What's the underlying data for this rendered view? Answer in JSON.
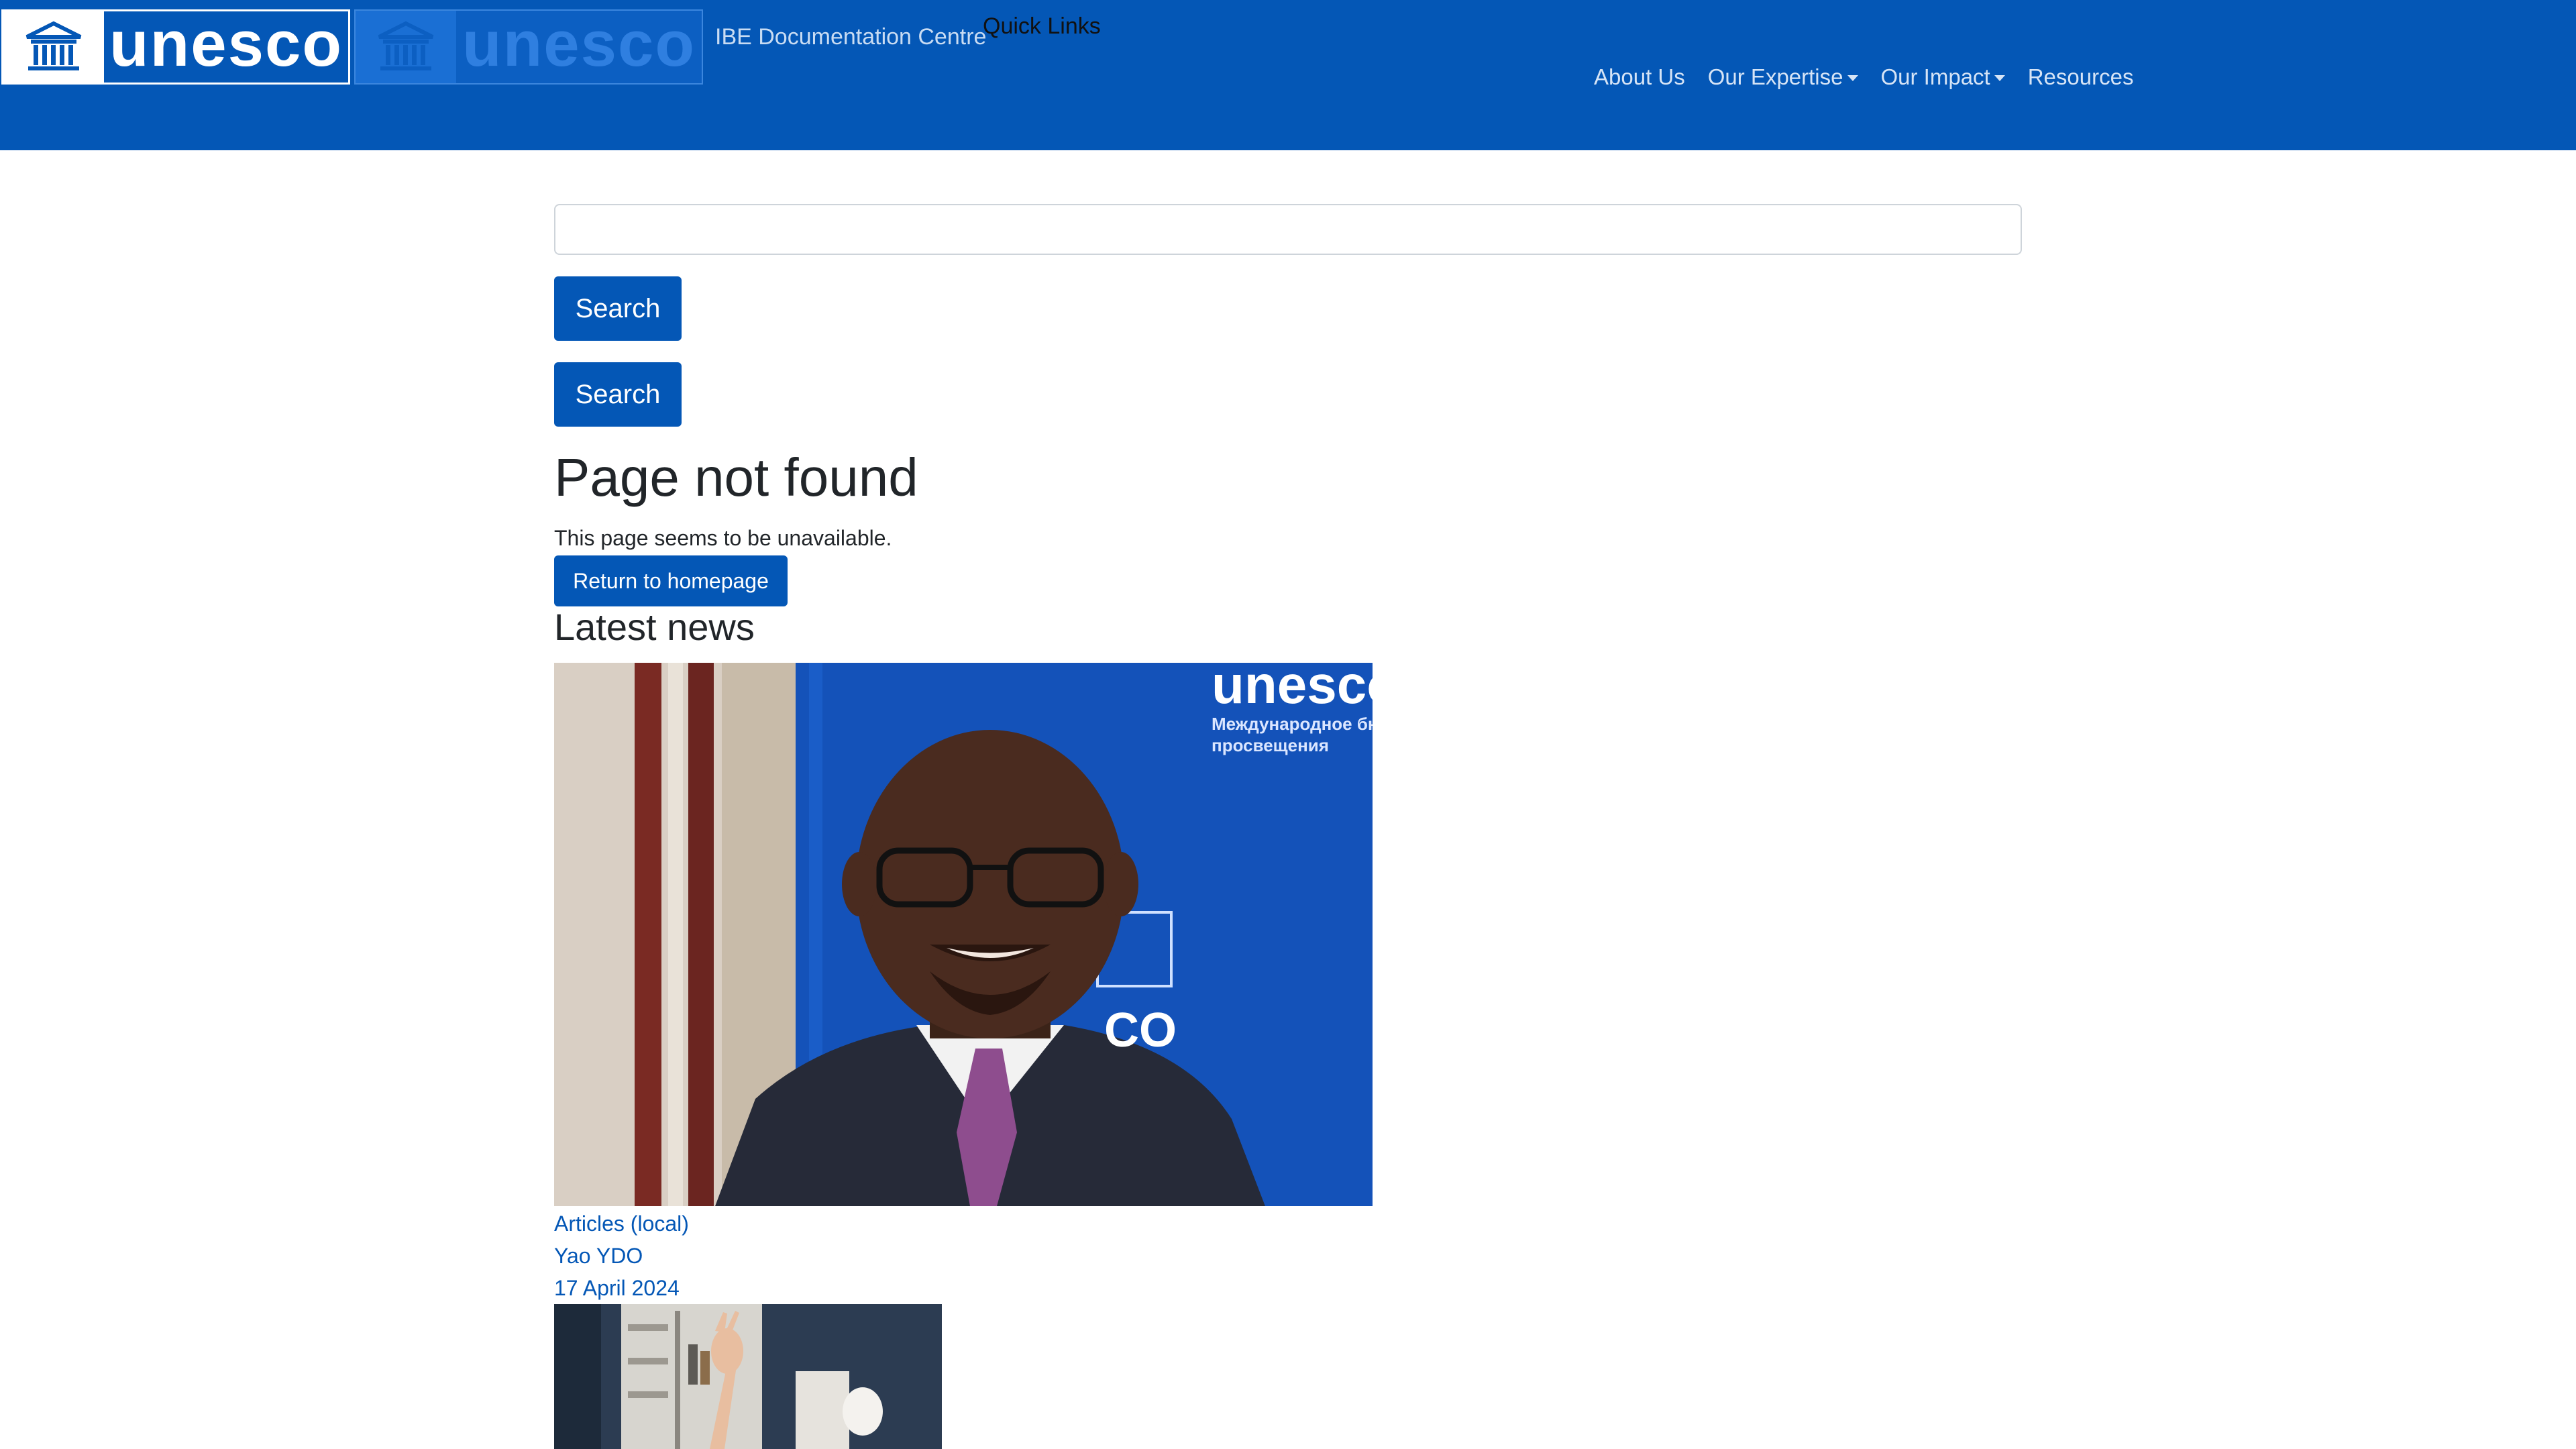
{
  "header": {
    "logo_text": "unesco",
    "logo_text_secondary": "unesco",
    "site_name": "IBE Documentation Centre",
    "quick_links": "Quick Links",
    "nav": [
      {
        "label": "About Us",
        "has_dropdown": false
      },
      {
        "label": "Our Expertise",
        "has_dropdown": true
      },
      {
        "label": "Our Impact",
        "has_dropdown": true
      },
      {
        "label": "Resources",
        "has_dropdown": false
      }
    ]
  },
  "search": {
    "value": "",
    "button_label": "Search",
    "button_label_2": "Search"
  },
  "error": {
    "title": "Page not found",
    "message": "This page seems to be unavailable.",
    "home_button": "Return to homepage"
  },
  "news": {
    "heading": "Latest news",
    "items": [
      {
        "image_overlay_brand": "unesco",
        "image_overlay_line1": "Международное бю",
        "image_overlay_line2": "просвещения",
        "image_overlay_co": "CO",
        "category": "Articles (local)",
        "author": "Yao YDO",
        "date": "17 April 2024"
      }
    ]
  },
  "colors": {
    "brand_blue": "#0457b6",
    "header_bg": "#0457b6",
    "link": "#0457b6"
  },
  "icons": [
    "unesco-temple-emblem-icon",
    "chevron-down-icon"
  ]
}
